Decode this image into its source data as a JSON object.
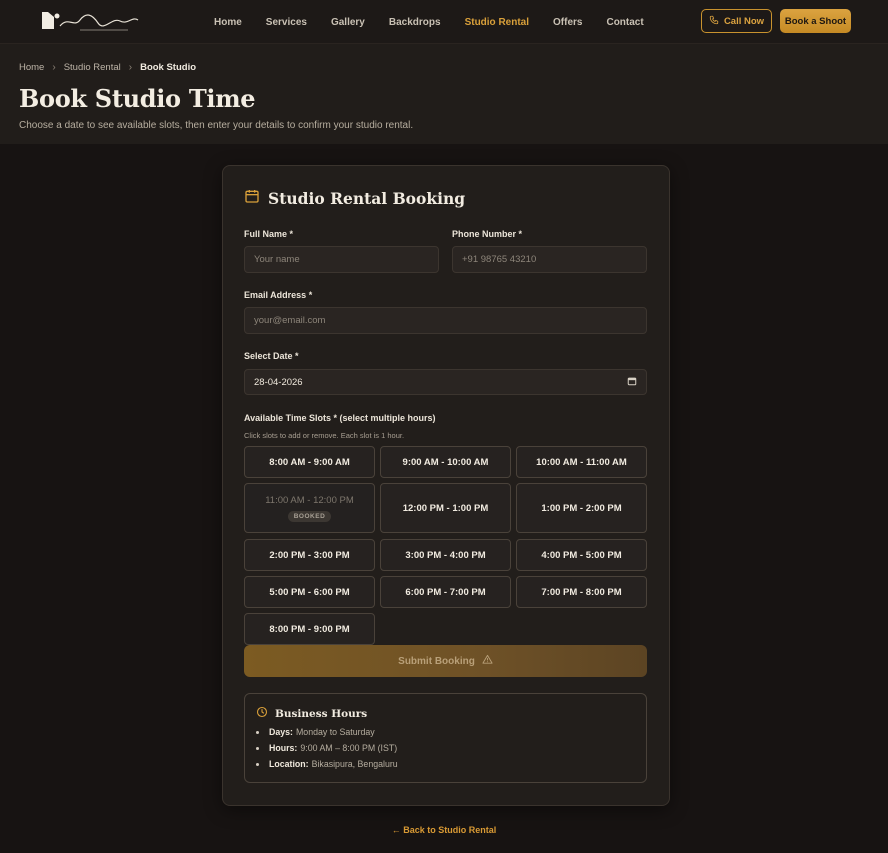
{
  "header": {
    "logo_script": "Raj Balaji",
    "logo_caption": "PHOTOGRAPHY",
    "nav": [
      {
        "label": "Home"
      },
      {
        "label": "Services"
      },
      {
        "label": "Gallery"
      },
      {
        "label": "Backdrops"
      },
      {
        "label": "Studio Rental",
        "active": true
      },
      {
        "label": "Offers"
      },
      {
        "label": "Contact"
      }
    ],
    "call_label": "Call Now",
    "book_label": "Book a Shoot",
    "accent": "#d9a03a"
  },
  "breadcrumb": [
    "Home",
    "Studio Rental",
    "Book Studio"
  ],
  "page": {
    "title": "Book Studio Time",
    "subtitle": "Choose a date to see available slots, then enter your details to confirm your studio rental."
  },
  "form": {
    "title": "Studio Rental Booking",
    "title_icon": "calendar-icon",
    "full_name": {
      "label": "Full Name *",
      "placeholder": "Your name",
      "value": ""
    },
    "phone": {
      "label": "Phone Number *",
      "placeholder": "+91 98765 43210",
      "value": ""
    },
    "email": {
      "label": "Email Address *",
      "placeholder": "your@email.com",
      "value": ""
    },
    "date": {
      "label": "Select Date *",
      "value": "28-04-2026"
    },
    "slots_label": "Available Time Slots * (select multiple hours)",
    "slots_hint": "Click slots to add or remove. Each slot is 1 hour.",
    "slots": [
      {
        "label": "8:00 AM - 9:00 AM"
      },
      {
        "label": "9:00 AM - 10:00 AM"
      },
      {
        "label": "10:00 AM - 11:00 AM"
      },
      {
        "label": "11:00 AM - 12:00 PM",
        "badge": "BOOKED"
      },
      {
        "label": "12:00 PM - 1:00 PM"
      },
      {
        "label": "1:00 PM - 2:00 PM"
      },
      {
        "label": "2:00 PM - 3:00 PM"
      },
      {
        "label": "3:00 PM - 4:00 PM"
      },
      {
        "label": "4:00 PM - 5:00 PM"
      },
      {
        "label": "5:00 PM - 6:00 PM"
      },
      {
        "label": "6:00 PM - 7:00 PM"
      },
      {
        "label": "7:00 PM - 8:00 PM"
      },
      {
        "label": "8:00 PM - 9:00 PM"
      }
    ],
    "submit_label": "Submit Booking",
    "submit_icon": "warning-icon"
  },
  "business_hours": {
    "title": "Business Hours",
    "icon": "clock-icon",
    "rows": [
      {
        "key": "Days:",
        "value": "Monday to Saturday"
      },
      {
        "key": "Hours:",
        "value": "9:00 AM – 8:00 PM (IST)"
      },
      {
        "key": "Location:",
        "value": "Bikasipura, Bengaluru"
      }
    ]
  },
  "back_link": "← Back to Studio Rental"
}
